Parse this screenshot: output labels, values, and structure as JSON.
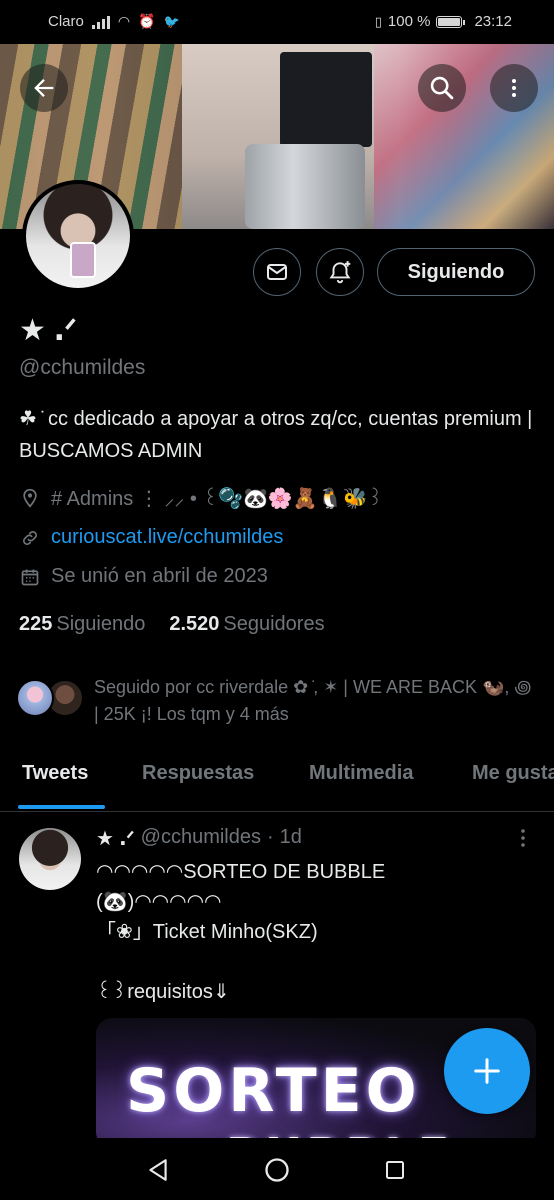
{
  "status_bar": {
    "carrier": "Claro",
    "battery": "100 %",
    "time": "23:12"
  },
  "profile": {
    "name": "★ ․ᐟ",
    "handle": "@cchumildes",
    "bio": "☘︎ ̇ cc dedicado a apoyar a otros zq/cc, cuentas premium | BUSCAMOS ADMIN",
    "location": "# Admins ⋮ ⸝⸝ • ꒰🫧🐼🌸🧸🐧🐝꒱",
    "link": "curiouscat.live/cchumildes",
    "joined": "Se unió en abril de 2023",
    "following_count": "225",
    "following_label": "Siguiendo",
    "followers_count": "2.520",
    "followers_label": "Seguidores",
    "followed_by": "Seguido por cc riverdale ✿ ̇, ✶ | WE ARE BACK 🦦, ꩜ | 25K ¡! Los tqm y 4 más"
  },
  "actions": {
    "follow_label": "Siguiendo"
  },
  "tabs": [
    "Tweets",
    "Respuestas",
    "Multimedia",
    "Me gusta"
  ],
  "active_tab": "Tweets",
  "tweet": {
    "name": "★ ․ᐟ",
    "handle": "@cchumildes",
    "sep": "·",
    "time": "1d",
    "body": "◠◠◠◠◠SORTEO DE BUBBLE\n(🐼)◠◠◠◠◠\n「❀」Ticket Minho(SKZ)\n\n꒰꒱requisitos⇓",
    "media_text": "SORTEO",
    "media_subtext": "BUBBLE"
  },
  "colors": {
    "accent": "#1d9bf0",
    "background": "#000000",
    "secondary_text": "#71767b"
  }
}
